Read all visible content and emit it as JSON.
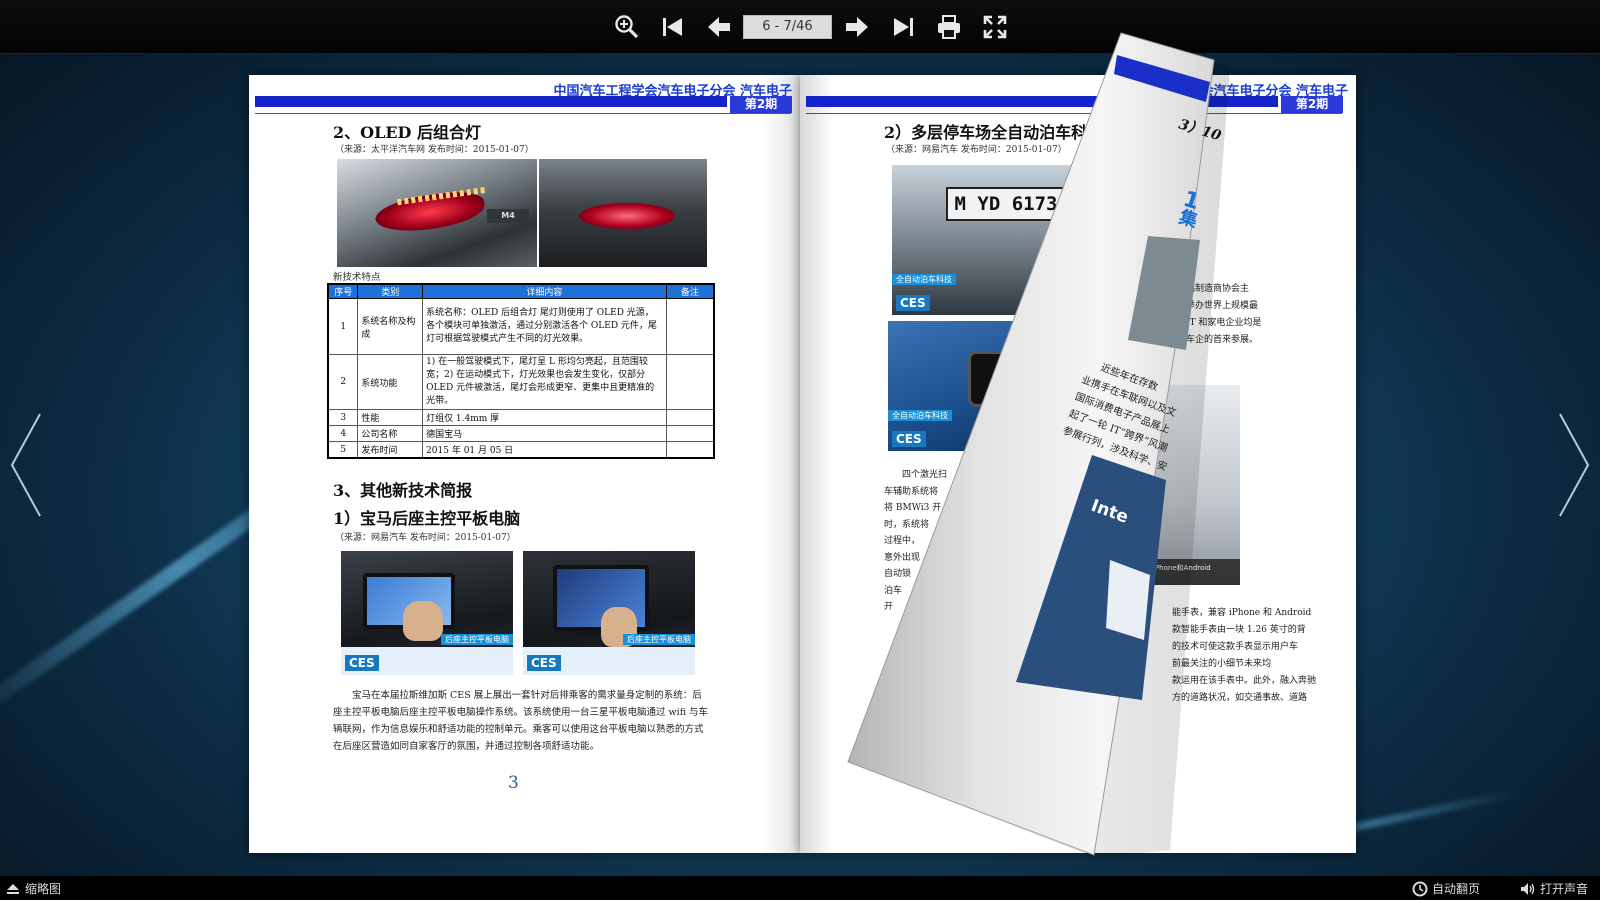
{
  "toolbar": {
    "page_indicator": "6 - 7/46",
    "icons": [
      "zoom-in-icon",
      "first-page-icon",
      "previous-page-icon",
      "next-page-icon",
      "last-page-icon",
      "print-icon",
      "fullscreen-icon"
    ]
  },
  "bottom_bar": {
    "thumbnails_label": "缩略图",
    "auto_flip_label": "自动翻页",
    "sound_label": "打开声音"
  },
  "left_page": {
    "header": "中国汽车工程学会汽车电子分会 汽车电子",
    "issue": "第2期",
    "section2_title": "2、OLED 后组合灯",
    "section2_source": "（来源：太平洋汽车网 发布时间：2015-01-07）",
    "table_caption": "新技术特点",
    "table_headers": [
      "序号",
      "类别",
      "详细内容",
      "备注"
    ],
    "table_rows": [
      {
        "no": "1",
        "cat": "系统名称及构成",
        "detail": "系统名称：OLED 后组合灯 尾灯则使用了 OLED 光源，各个模块可单独激活，通过分别激活各个 OLED 元件，尾灯可根据驾驶模式产生不同的灯光效果。",
        "note": ""
      },
      {
        "no": "2",
        "cat": "系统功能",
        "detail": "1) 在一般驾驶模式下，尾灯呈 L 形均匀亮起，且范围较宽；2) 在运动模式下，灯光效果也会发生变化，仅部分 OLED 元件被激活，尾灯会形成更窄、更集中且更精准的光带。",
        "note": ""
      },
      {
        "no": "3",
        "cat": "性能",
        "detail": "灯组仅 1.4mm 厚",
        "note": ""
      },
      {
        "no": "4",
        "cat": "公司名称",
        "detail": "德国宝马",
        "note": ""
      },
      {
        "no": "5",
        "cat": "发布时间",
        "detail": "2015 年 01 月 05 日",
        "note": ""
      }
    ],
    "section3_title": "3、其他新技术简报",
    "sub1_title": "1）宝马后座主控平板电脑",
    "sub1_source": "（来源：网易汽车 发布时间：2015-01-07）",
    "photo_caption": "后座主控平板电脑",
    "ces_label": "CES",
    "paragraph": "宝马在本届拉斯维加斯 CES 展上展出一套针对后排乘客的需求量身定制的系统：后座主控平板电脑后座主控平板电脑操作系统。该系统使用一台三星平板电脑通过 wifi 与车辆联网，作为信息娱乐和舒适功能的控制单元。乘客可以使用这台平板电脑以熟悉的方式在后座区营造如同自家客厅的氛围，并通过控制各项舒适功能。",
    "page_number": "3"
  },
  "right_page": {
    "header": "中国汽车工程学会汽车电子分会 汽车电子",
    "issue": "第2期",
    "sub2_title": "2）多层停车场全自动泊车科",
    "sub2_source": "（来源：网易汽车 发布时间：2015-01-07）",
    "plate": "M YD 6173",
    "photo_caption": "全自动泊车科技",
    "ces_label": "CES",
    "para_lines": [
      "四个激光扫",
      "车辅助系统将",
      "将 BMWi3 开",
      "时，系统将",
      "过程中，",
      "意外出现",
      "自动锁",
      "泊车",
      "开"
    ],
    "right_col_lines": [
      "品制造商协会主",
      "举办世界上规模最",
      "IT 和家电企业均是",
      "车企的首来参展。"
    ],
    "bottom_right_lines": [
      "能手表，兼容 iPhone 和 Android",
      "款智能手表由一块 1.26 英寸的背",
      "的技术可使这款手表显示用户车",
      "前最关注的小细节未来均",
      "款运用在该手表中。此外，融入奔驰",
      "方的道路状况，如交通事故、道路"
    ],
    "photo2_caption": "兼容iPhone和Android"
  },
  "flip_page": {
    "heading": "3）10",
    "big_digit": "1",
    "big_char": "集",
    "lines": [
      "近些年在存数",
      "业携手在车联网以及文",
      "国际消费电子产品展上",
      "起了一轮 IT“跨界”风潮",
      "参展行列，涉及科学、安"
    ],
    "ces_word": "Inte"
  }
}
